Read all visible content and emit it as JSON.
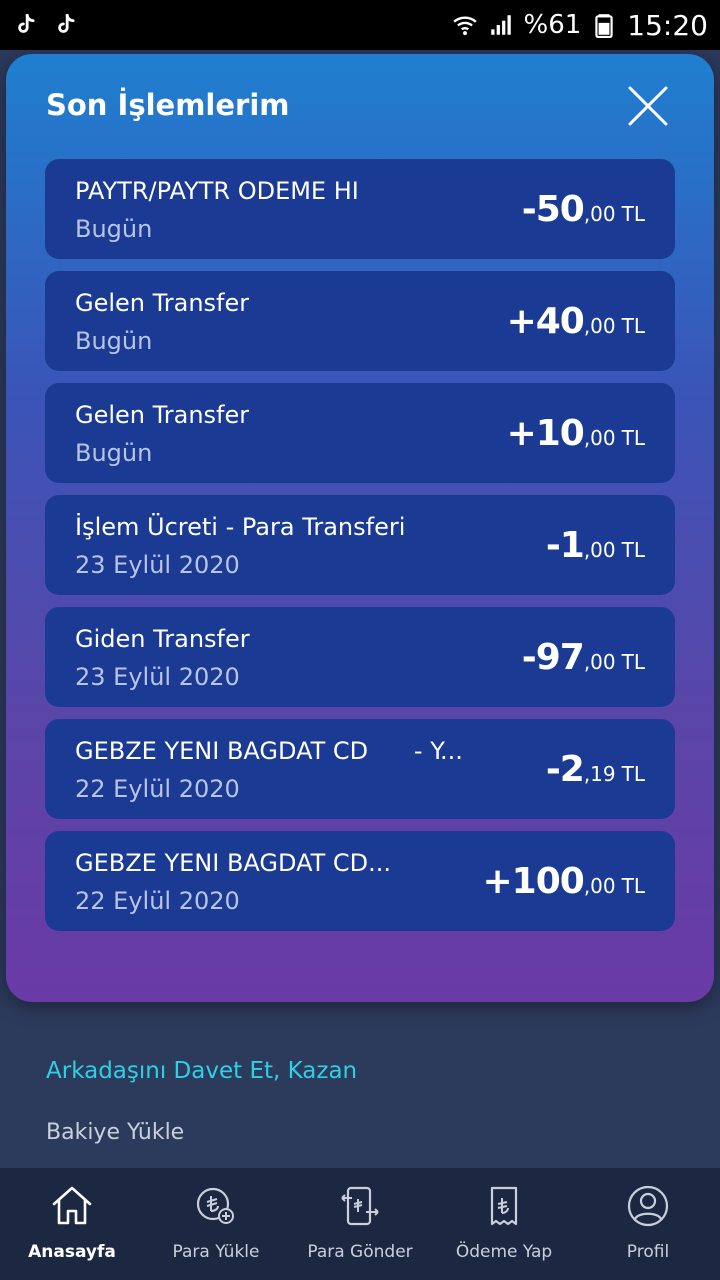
{
  "status_bar": {
    "battery": "%61",
    "time": "15:20"
  },
  "modal": {
    "title": "Son İşlemlerim",
    "transactions": [
      {
        "title": "PAYTR/PAYTR ODEME HI",
        "date": "Bugün",
        "amount_int": "-50",
        "amount_dec": ",00",
        "currency": "TL"
      },
      {
        "title": "Gelen Transfer",
        "date": "Bugün",
        "amount_int": "+40",
        "amount_dec": ",00",
        "currency": "TL"
      },
      {
        "title": "Gelen Transfer",
        "date": "Bugün",
        "amount_int": "+10",
        "amount_dec": ",00",
        "currency": "TL"
      },
      {
        "title": "İşlem Ücreti - Para Transferi",
        "date": "23 Eylül 2020",
        "amount_int": "-1",
        "amount_dec": ",00",
        "currency": "TL"
      },
      {
        "title": "Giden Transfer",
        "date": "23 Eylül 2020",
        "amount_int": "-97",
        "amount_dec": ",00",
        "currency": "TL"
      },
      {
        "title": "GEBZE YENI BAGDAT CD      - Y...",
        "date": "22 Eylül 2020",
        "amount_int": "-2",
        "amount_dec": ",19",
        "currency": "TL"
      },
      {
        "title": "GEBZE YENI BAGDAT CD...",
        "date": "22 Eylül 2020",
        "amount_int": "+100",
        "amount_dec": ",00",
        "currency": "TL"
      }
    ]
  },
  "background": {
    "invite_link": "Arkadaşını Davet Et, Kazan",
    "balance_link": "Bakiye Yükle"
  },
  "bottom_nav": {
    "items": [
      {
        "label": "Anasayfa",
        "icon": "home-icon"
      },
      {
        "label": "Para Yükle",
        "icon": "add-money-icon"
      },
      {
        "label": "Para Gönder",
        "icon": "send-money-icon"
      },
      {
        "label": "Ödeme Yap",
        "icon": "receipt-icon"
      },
      {
        "label": "Profil",
        "icon": "profile-icon"
      }
    ]
  },
  "colors": {
    "card": "#1a3a94",
    "accent_link": "#2fd0e6",
    "nav_bg": "#1c2842"
  }
}
